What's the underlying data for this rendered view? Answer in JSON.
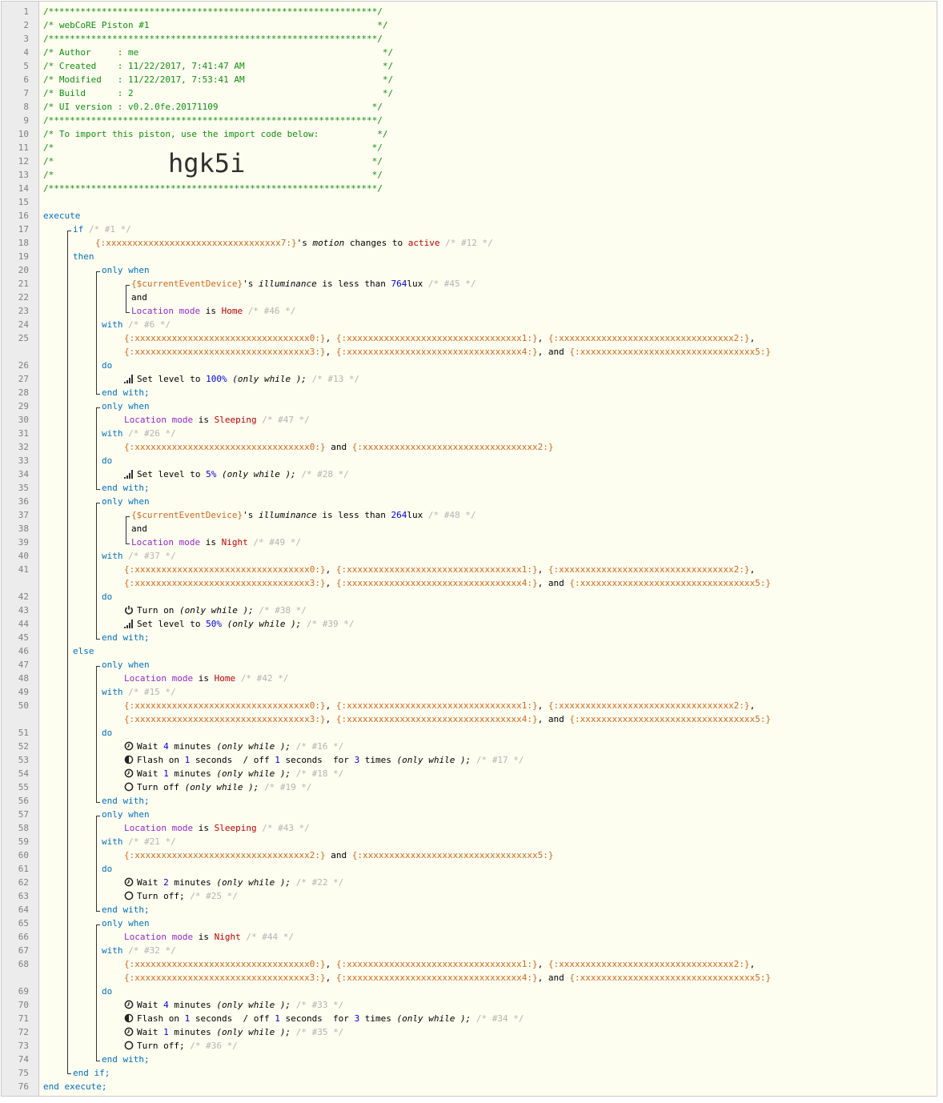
{
  "line_numbers": [
    "1",
    "2",
    "3",
    "4",
    "5",
    "6",
    "7",
    "8",
    "9",
    "10",
    "11",
    "12",
    "13",
    "14",
    "15",
    "16",
    "17",
    "18",
    "19",
    "20",
    "21",
    "22",
    "23",
    "24",
    "25",
    "26",
    "27",
    "28",
    "29",
    "30",
    "31",
    "32",
    "33",
    "34",
    "35",
    "36",
    "37",
    "38",
    "39",
    "40",
    "41",
    "42",
    "43",
    "44",
    "45",
    "46",
    "47",
    "48",
    "49",
    "50",
    "51",
    "52",
    "53",
    "54",
    "55",
    "56",
    "57",
    "58",
    "59",
    "60",
    "61",
    "62",
    "63",
    "64",
    "65",
    "66",
    "67",
    "68",
    "69",
    "70",
    "71",
    "72",
    "73",
    "74",
    "75",
    "76"
  ],
  "header": {
    "border": "/**************************************************************/",
    "title": "/* webCoRE Piston #1                                           */",
    "author": "/* Author     : me                                              */",
    "created": "/* Created    : 11/22/2017, 7:41:47 AM                          */",
    "modified": "/* Modified   : 11/22/2017, 7:53:41 AM                          */",
    "build": "/* Build      : 2                                               */",
    "ui_version": "/* UI version : v0.2.0fe.20171109                             */",
    "import_note": "/* To import this piston, use the import code below:           */",
    "blank": "/*                                                            */",
    "import_code": "hgk5i"
  },
  "kw": {
    "execute": "execute",
    "if": "if",
    "then": "then",
    "else": "else",
    "only_when": "only when",
    "with": "with",
    "do": "do",
    "end_with": "end with;",
    "end_if": "end if;",
    "end_execute": "end execute;",
    "and": "and"
  },
  "text": {
    "is": " is ",
    "is_less_than": " is less than ",
    "s": "'s ",
    "changes_to": " changes to ",
    "only_while": "(only while );",
    "lux": "lux",
    "minutes": " minutes ",
    "seconds": " seconds ",
    "for": " for ",
    "times": " times ",
    "off_sep": " / off ",
    "flash_on": "Flash on ",
    "wait": "Wait ",
    "set_level_to": "Set level to ",
    "turn_on": "Turn on ",
    "turn_off_while": "Turn off ",
    "turn_off": "Turn off;",
    "comma": ", ",
    "and_sep": ", and ",
    "and_mid": " and "
  },
  "devices": {
    "d7": "{:xxxxxxxxxxxxxxxxxxxxxxxxxxxxxxxxx7:}",
    "d0": "{:xxxxxxxxxxxxxxxxxxxxxxxxxxxxxxxxx0:}",
    "d1": "{:xxxxxxxxxxxxxxxxxxxxxxxxxxxxxxxxx1:}",
    "d2": "{:xxxxxxxxxxxxxxxxxxxxxxxxxxxxxxxxx2:}",
    "d3": "{:xxxxxxxxxxxxxxxxxxxxxxxxxxxxxxxxx3:}",
    "d4": "{:xxxxxxxxxxxxxxxxxxxxxxxxxxxxxxxxx4:}",
    "d5": "{:xxxxxxxxxxxxxxxxxxxxxxxxxxxxxxxxx5:}",
    "current": "{$currentEventDevice}"
  },
  "attrs": {
    "motion": "motion",
    "illuminance": "illuminance"
  },
  "values": {
    "active": "active",
    "location_mode": "Location mode",
    "home": "Home",
    "sleeping": "Sleeping",
    "night": "Night",
    "lux764": "764",
    "lux264": "264",
    "pct100": "100%",
    "pct5": "5%",
    "pct50": "50%",
    "n1": "1",
    "n2": "2",
    "n3": "3",
    "n4": "4"
  },
  "comments": {
    "c1": "/* #1 */",
    "c12": "/* #12 */",
    "c45": "/* #45 */",
    "c46": "/* #46 */",
    "c6": "/* #6 */",
    "c13": "/* #13 */",
    "c47": "/* #47 */",
    "c26": "/* #26 */",
    "c28": "/* #28 */",
    "c48": "/* #48 */",
    "c49": "/* #49 */",
    "c37": "/* #37 */",
    "c38": "/* #38 */",
    "c39": "/* #39 */",
    "c42": "/* #42 */",
    "c15": "/* #15 */",
    "c16": "/* #16 */",
    "c17": "/* #17 */",
    "c18": "/* #18 */",
    "c19": "/* #19 */",
    "c43": "/* #43 */",
    "c21": "/* #21 */",
    "c22": "/* #22 */",
    "c25": "/* #25 */",
    "c44": "/* #44 */",
    "c32": "/* #32 */",
    "c33": "/* #33 */",
    "c34": "/* #34 */",
    "c35": "/* #35 */",
    "c36": "/* #36 */"
  },
  "icons": {
    "level": "signal-bars-icon",
    "power": "power-icon",
    "wait": "clock-icon",
    "flash": "half-circle-icon",
    "off": "circle-outline-icon"
  },
  "colors": {
    "header_comment": "#109010",
    "keyword": "#0070c0",
    "device": "#d2691e",
    "expression": "#c00000",
    "variable": "#9428d0",
    "number": "#0000e0",
    "comment": "#b4b4b4"
  }
}
